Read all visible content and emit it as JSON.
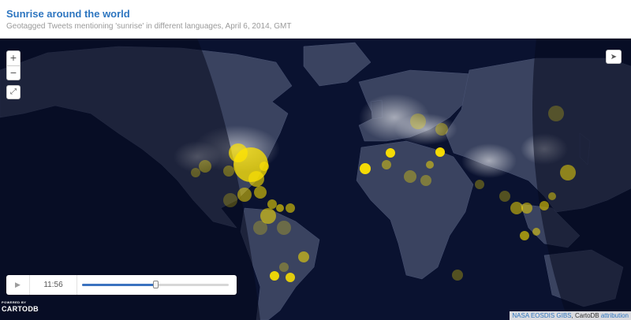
{
  "header": {
    "title": "Sunrise around the world",
    "subtitle": "Geotagged Tweets mentioning 'sunrise' in different languages, April 6, 2014, GMT"
  },
  "map_controls": {
    "zoom_in_label": "+",
    "zoom_out_label": "−",
    "fullscreen_icon": "expand-icon",
    "share_icon": "paper-plane-icon"
  },
  "player": {
    "play_icon": "▶",
    "time": "11:56",
    "progress": 0.5
  },
  "logo": {
    "powered_by": "POWERED BY",
    "brand": "CARTODB"
  },
  "attribution": {
    "nasa": "NASA EOSDIS GIBS",
    "sep": ", CartoDB ",
    "link": "attribution"
  },
  "colors": {
    "title_blue": "#2e76c0",
    "map_background": "#0a1230",
    "land": "#3a4360",
    "night_overlay": "#050a1d",
    "tweet_dot": "#ffe400"
  }
}
